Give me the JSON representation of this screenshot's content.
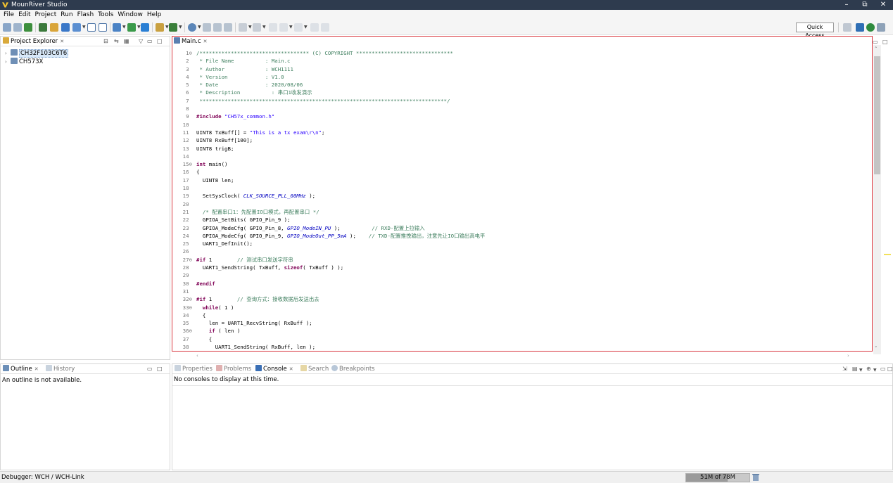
{
  "window": {
    "title": "MounRiver Studio",
    "minimize": "–",
    "restore": "⧉",
    "close": "✕"
  },
  "menu": [
    "File",
    "Edit",
    "Project",
    "Run",
    "Flash",
    "Tools",
    "Window",
    "Help"
  ],
  "toolbar": {
    "quick_access": "Quick Access"
  },
  "project_explorer": {
    "tab": "Project Explorer",
    "items": [
      {
        "label": "CH32F103C6T6",
        "selected": true
      },
      {
        "label": "CH573X",
        "selected": false
      }
    ]
  },
  "editor": {
    "tab": "Main.c",
    "lines": [
      {
        "n": "1",
        "fold": true,
        "text": "/*********************************** (C) COPYRIGHT *******************************"
      },
      {
        "n": "2",
        "text": " * File Name          : Main.c"
      },
      {
        "n": "3",
        "text": " * Author             : WCH1111"
      },
      {
        "n": "4",
        "text": " * Version            : V1.0"
      },
      {
        "n": "5",
        "text": " * Date               : 2020/08/06"
      },
      {
        "n": "6",
        "text": " * Description          : 串口1收发演示"
      },
      {
        "n": "7",
        "text": " *******************************************************************************/"
      },
      {
        "n": "8",
        "text": ""
      },
      {
        "n": "9",
        "text": "#include \"CH57x_common.h\""
      },
      {
        "n": "10",
        "text": ""
      },
      {
        "n": "11",
        "text": "UINT8 TxBuff[] = \"This is a tx exam\\r\\n\";"
      },
      {
        "n": "12",
        "text": "UINT8 RxBuff[100];"
      },
      {
        "n": "13",
        "text": "UINT8 trigB;"
      },
      {
        "n": "14",
        "text": ""
      },
      {
        "n": "15",
        "fold": true,
        "text": "int main()"
      },
      {
        "n": "16",
        "text": "{"
      },
      {
        "n": "17",
        "text": "  UINT8 len;"
      },
      {
        "n": "18",
        "text": ""
      },
      {
        "n": "19",
        "text": "  SetSysClock( CLK_SOURCE_PLL_60MHz );"
      },
      {
        "n": "20",
        "text": ""
      },
      {
        "n": "21",
        "text": "  /* 配置串口1：先配置IO口模式，再配置串口 */"
      },
      {
        "n": "22",
        "text": "  GPIOA_SetBits( GPIO_Pin_9 );"
      },
      {
        "n": "23",
        "text": "  GPIOA_ModeCfg( GPIO_Pin_8, GPIO_ModeIN_PU );          // RXD-配置上拉输入"
      },
      {
        "n": "24",
        "text": "  GPIOA_ModeCfg( GPIO_Pin_9, GPIO_ModeOut_PP_5mA );    // TXD-配置推挽输出，注意先让IO口输出高电平"
      },
      {
        "n": "25",
        "text": "  UART1_DefInit();"
      },
      {
        "n": "26",
        "text": ""
      },
      {
        "n": "27",
        "fold": true,
        "text": "#if 1        // 测试串口发送字符串"
      },
      {
        "n": "28",
        "text": "  UART1_SendString( TxBuff, sizeof( TxBuff ) );"
      },
      {
        "n": "29",
        "text": ""
      },
      {
        "n": "30",
        "text": "#endif"
      },
      {
        "n": "31",
        "text": ""
      },
      {
        "n": "32",
        "fold": true,
        "text": "#if 1        // 查询方式：接收数据后发送出去"
      },
      {
        "n": "33",
        "fold": true,
        "text": "  while( 1 )"
      },
      {
        "n": "34",
        "text": "  {"
      },
      {
        "n": "35",
        "text": "    len = UART1_RecvString( RxBuff );"
      },
      {
        "n": "36",
        "fold": true,
        "text": "    if ( len )"
      },
      {
        "n": "37",
        "text": "    {"
      },
      {
        "n": "38",
        "text": "      UART1_SendString( RxBuff, len );"
      }
    ]
  },
  "outline": {
    "tab": "Outline",
    "history_tab": "History",
    "message": "An outline is not available."
  },
  "bottom_tabs": {
    "properties": "Properties",
    "problems": "Problems",
    "console": "Console",
    "search": "Search",
    "breakpoints": "Breakpoints",
    "console_message": "No consoles to display at this time."
  },
  "status": {
    "debugger": "Debugger: WCH / WCH-Link",
    "heap": "51M of 78M",
    "heap_used_fraction": 0.65
  },
  "colors": {
    "titlebar": "#2e3b4e",
    "editor_border": "#d9363e",
    "comment": "#3f7f5f",
    "keyword": "#7f0055",
    "string": "#2a00ff"
  }
}
